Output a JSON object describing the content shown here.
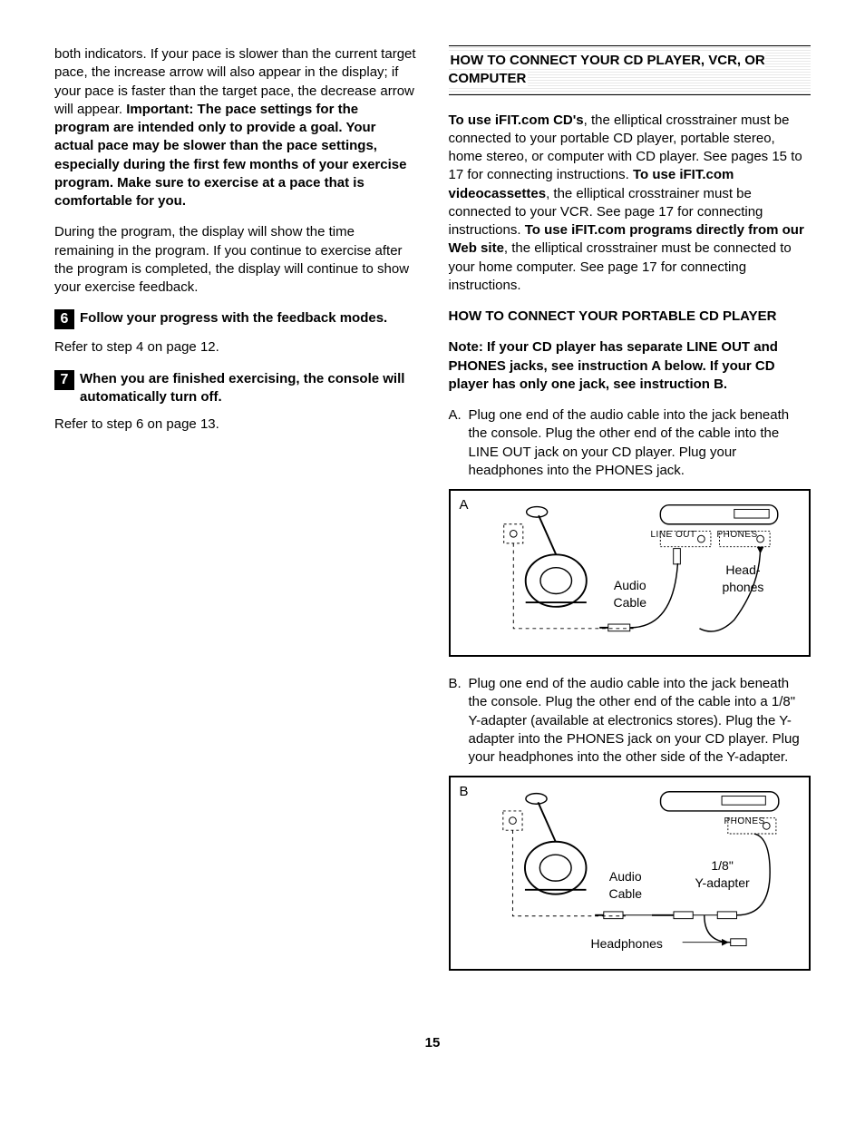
{
  "left": {
    "p1a": "both indicators. If your pace is slower than the current target pace, the increase arrow will also appear in the display; if your pace is faster than the target pace, the decrease arrow will appear. ",
    "p1b": "Important: The pace settings for the program are intended only to provide a goal. Your actual pace may be slower than the pace settings, especially during the first few months of your exercise program. Make sure to exercise at a pace that is comfortable for you.",
    "p2": "During the program, the display will show the time remaining in the program. If you continue to exercise after the program is completed, the display will continue to show your exercise feedback.",
    "step6num": "6",
    "step6": "Follow your progress with the feedback modes.",
    "step6ref": "Refer to step 4 on page 12.",
    "step7num": "7",
    "step7": "When you are finished exercising, the console will automatically turn off.",
    "step7ref": "Refer to step 6 on page 13."
  },
  "right": {
    "title": "HOW TO CONNECT YOUR CD PLAYER, VCR, OR COMPUTER",
    "intro1a": "To use iFIT.com CD's",
    "intro1b": ", the elliptical crosstrainer must be connected to your portable CD player, portable stereo, home stereo, or computer with CD player. See pages 15 to 17 for connecting instructions. ",
    "intro1c": "To use iFIT.com videocassettes",
    "intro1d": ", the elliptical crosstrainer must be connected to your VCR. See page 17 for connecting instructions. ",
    "intro1e": "To use iFIT.com programs directly from our Web site",
    "intro1f": ", the elliptical crosstrainer must be connected to your home computer. See page 17 for connecting instructions.",
    "sub1": "HOW TO CONNECT YOUR PORTABLE CD PLAYER",
    "note": "Note: If your CD player has separate LINE OUT and PHONES jacks, see instruction A below. If your CD player has only one jack, see instruction B.",
    "a_marker": "A.",
    "a_text": "Plug one end of the audio cable into the jack beneath the console. Plug the other end of the cable into the LINE OUT jack on your CD player. Plug your headphones into the PHONES jack.",
    "b_marker": "B.",
    "b_text": "Plug one end of the audio cable into the jack beneath the console. Plug the other end of the cable into a 1/8\" Y-adapter (available at electronics stores). Plug the Y-adapter into the PHONES jack on your CD player. Plug your headphones into the other side of the Y-adapter.",
    "diagA": {
      "letter": "A",
      "lineout": "LINE OUT",
      "phones": "PHONES",
      "audio": "Audio",
      "cable": "Cable",
      "head": "Head-",
      "phones2": "phones"
    },
    "diagB": {
      "letter": "B",
      "phones": "PHONES",
      "audio": "Audio",
      "cable": "Cable",
      "eighth": "1/8\"",
      "yadapter": "Y-adapter",
      "headphones": "Headphones"
    }
  },
  "page": "15"
}
